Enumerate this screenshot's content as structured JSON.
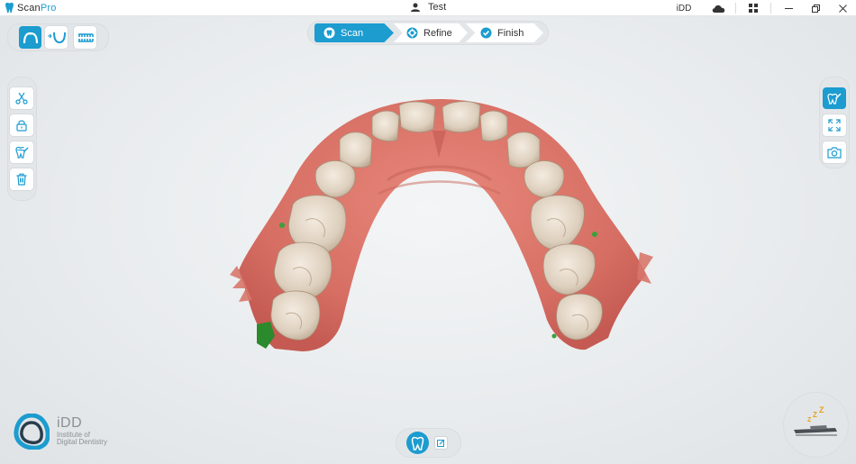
{
  "titlebar": {
    "app_name_main": "Scan",
    "app_name_accent": "Pro",
    "user_name": "Test",
    "brand_code": "iDD",
    "icons": [
      "tooth-logo-icon",
      "user-icon",
      "cloud-icon",
      "grid-icon",
      "minimize-icon",
      "restore-icon",
      "close-icon"
    ]
  },
  "jaw_selector": {
    "items": [
      {
        "name": "upper-jaw-icon",
        "active": true
      },
      {
        "name": "lower-jaw-icon",
        "active": false
      },
      {
        "name": "bite-icon",
        "active": false
      }
    ]
  },
  "stepper": {
    "steps": [
      {
        "label": "Scan",
        "icon": "tooth-icon",
        "active": true
      },
      {
        "label": "Refine",
        "icon": "gear-icon",
        "active": false
      },
      {
        "label": "Finish",
        "icon": "check-icon",
        "active": false
      }
    ]
  },
  "left_toolbar": {
    "tools": [
      "scissors-icon",
      "lock-icon",
      "tooth-edit-icon",
      "trash-icon"
    ]
  },
  "right_toolbar": {
    "tools": [
      {
        "name": "texture-toggle-icon",
        "active": true
      },
      {
        "name": "fit-view-icon",
        "active": false
      },
      {
        "name": "camera-icon",
        "active": false
      }
    ]
  },
  "brand": {
    "name": "iDD",
    "line1": "Institute of",
    "line2": "Digital Dentistry"
  },
  "bottom_bar": {
    "icons": [
      "tooth-mode-icon",
      "edit-note-icon"
    ]
  },
  "status": {
    "icon": "scanner-sleep-icon",
    "text": "Z Z Z"
  },
  "colors": {
    "accent": "#1c9ccf",
    "panel": "#e3e6e9",
    "gum": "#d9756a",
    "tooth": "#e8dccc"
  }
}
